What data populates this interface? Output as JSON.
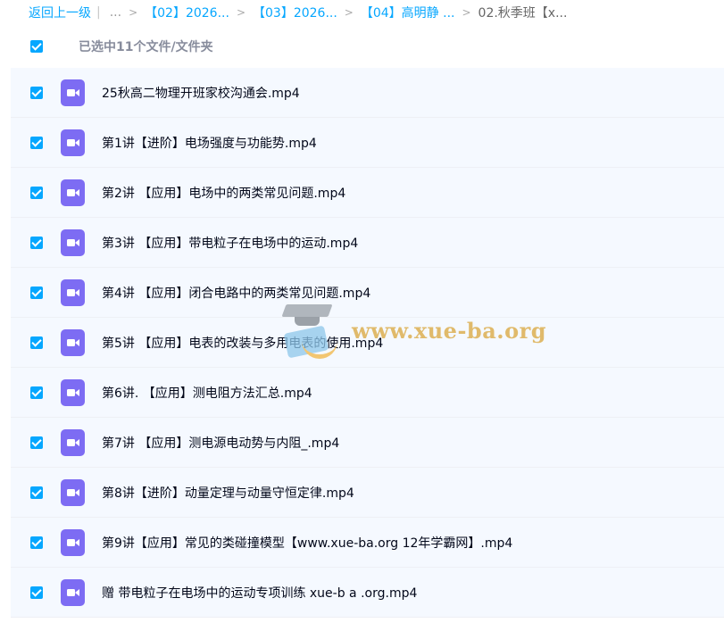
{
  "breadcrumb": {
    "back_label": "返回上一级",
    "separator": "|",
    "dots": "...",
    "items": [
      "【02】2026...",
      "【03】2026...",
      "【04】高明静 ..."
    ],
    "arrow": ">",
    "current": "02.秋季班【x..."
  },
  "header": {
    "selection_text": "已选中11个文件/文件夹"
  },
  "files": [
    {
      "name": "25秋高二物理开班家校沟通会.mp4"
    },
    {
      "name": "第1讲【进阶】电场强度与功能势.mp4"
    },
    {
      "name": "第2讲 【应用】电场中的两类常见问题.mp4"
    },
    {
      "name": "第3讲 【应用】带电粒子在电场中的运动.mp4"
    },
    {
      "name": "第4讲 【应用】闭合电路中的两类常见问题.mp4"
    },
    {
      "name": "第5讲 【应用】电表的改装与多用电表的使用.mp4"
    },
    {
      "name": "第6讲. 【应用】测电阻方法汇总.mp4"
    },
    {
      "name": "第7讲 【应用】测电源电动势与内阻_.mp4"
    },
    {
      "name": "第8讲【进阶】动量定理与动量守恒定律.mp4"
    },
    {
      "name": "第9讲【应用】常见的类碰撞模型【www.xue-ba.org 12年学霸网】.mp4"
    },
    {
      "name": "赠 带电粒子在电场中的运动专项训练 xue-b a .org.mp4"
    }
  ],
  "watermark": {
    "text": "www.xue-ba.org"
  },
  "colors": {
    "accent": "#06a7ff",
    "video_icon": "#7d6cf3",
    "row_bg": "#f5f9ff"
  },
  "icons": {
    "checkbox": "checked-checkbox-icon",
    "file": "video-file-icon"
  }
}
